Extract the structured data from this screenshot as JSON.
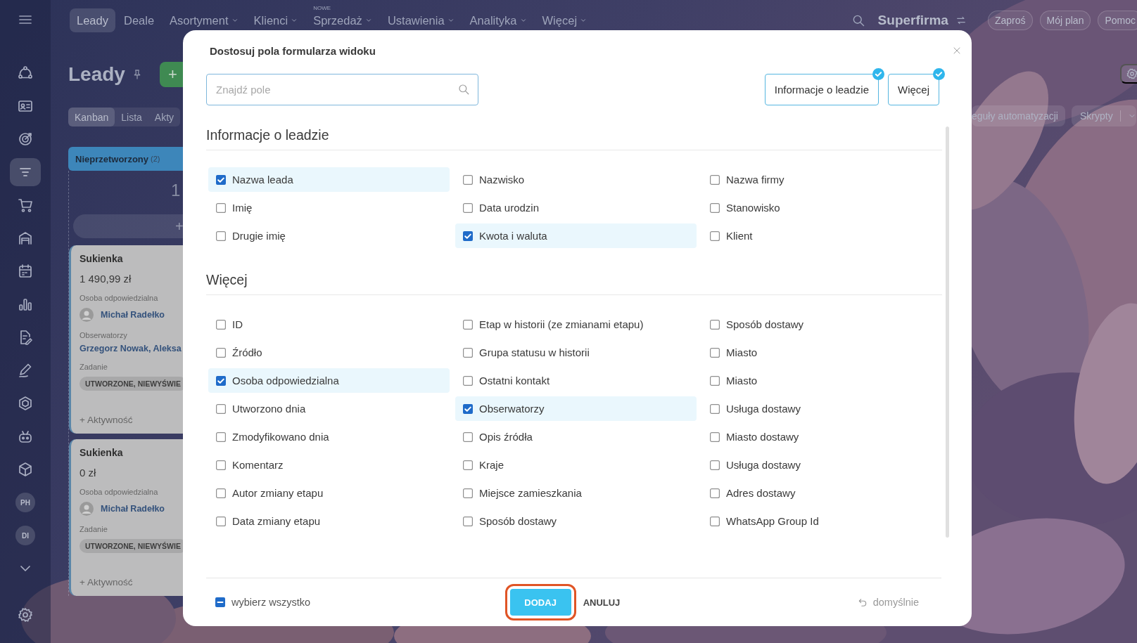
{
  "topbar": {
    "nav": [
      {
        "label": "Leady",
        "selected": true,
        "dropdown": false
      },
      {
        "label": "Deale",
        "selected": false,
        "dropdown": false
      },
      {
        "label": "Asortyment",
        "selected": false,
        "dropdown": true
      },
      {
        "label": "Klienci",
        "selected": false,
        "dropdown": true
      },
      {
        "label": "Sprzedaż",
        "selected": false,
        "dropdown": true,
        "badge": "NOWE"
      },
      {
        "label": "Ustawienia",
        "selected": false,
        "dropdown": true
      },
      {
        "label": "Analityka",
        "selected": false,
        "dropdown": true
      },
      {
        "label": "Więcej",
        "selected": false,
        "dropdown": true
      }
    ],
    "company": "Superfirma",
    "actions": [
      "Zaproś",
      "Mój plan",
      "Pomoc"
    ]
  },
  "sidebar": {
    "items": [
      {
        "kind": "network",
        "selected": false
      },
      {
        "kind": "contacts",
        "selected": false
      },
      {
        "kind": "target",
        "selected": false
      },
      {
        "kind": "funnel",
        "selected": true
      },
      {
        "kind": "cart",
        "selected": false
      },
      {
        "kind": "store",
        "selected": false
      },
      {
        "kind": "calendar",
        "selected": false
      },
      {
        "kind": "chart",
        "selected": false
      },
      {
        "kind": "document",
        "selected": false
      },
      {
        "kind": "pen",
        "selected": false
      },
      {
        "kind": "hexagon",
        "selected": false
      },
      {
        "kind": "robot",
        "selected": false
      },
      {
        "kind": "cube",
        "selected": false
      },
      {
        "kind": "avatar",
        "label": "PH",
        "selected": false
      },
      {
        "kind": "avatar",
        "label": "DI",
        "selected": false
      },
      {
        "kind": "more",
        "selected": false
      }
    ]
  },
  "page": {
    "title": "Leady",
    "add_label": "+",
    "view_tabs": [
      {
        "label": "Kanban",
        "selected": true
      },
      {
        "label": "Lista",
        "selected": false
      },
      {
        "label": "Akty",
        "selected": false
      }
    ],
    "toolbar": [
      "eguły automatyzacji",
      "Skrypty"
    ],
    "column": {
      "title": "Nieprzetworzony",
      "count": "(2)",
      "total": "1",
      "add_label": "+",
      "cards": [
        {
          "title": "Sukienka",
          "amount": "1 490,99 zł",
          "fields": [
            {
              "kind": "person",
              "label": "Osoba odpowiedzialna",
              "value": "Michał Radełko"
            },
            {
              "kind": "link",
              "label": "Obserwatorzy",
              "value": "Grzegorz Nowak, Aleksa"
            },
            {
              "kind": "tag",
              "label": "Zadanie",
              "value": "UTWORZONE, NIEWYŚWIE"
            }
          ],
          "activity": "+ Aktywność"
        },
        {
          "title": "Sukienka",
          "amount": "0 zł",
          "fields": [
            {
              "kind": "person",
              "label": "Osoba odpowiedzialna",
              "value": "Michał Radełko"
            },
            {
              "kind": "tag",
              "label": "Zadanie",
              "value": "UTWORZONE, NIEWYŚWIE"
            }
          ],
          "activity": "+ Aktywność"
        }
      ]
    }
  },
  "modal": {
    "title": "Dostosuj pola formularza widoku",
    "search": {
      "placeholder": "Znajdź pole"
    },
    "section_buttons": [
      {
        "label": "Informacje o leadzie",
        "checked": true
      },
      {
        "label": "Więcej",
        "checked": true
      }
    ],
    "sections": [
      {
        "title": "Informacje o leadzie",
        "fields": [
          {
            "label": "Nazwa leada",
            "checked": true
          },
          {
            "label": "Nazwisko",
            "checked": false
          },
          {
            "label": "Nazwa firmy",
            "checked": false
          },
          {
            "label": "Imię",
            "checked": false
          },
          {
            "label": "Data urodzin",
            "checked": false
          },
          {
            "label": "Stanowisko",
            "checked": false
          },
          {
            "label": "Drugie imię",
            "checked": false
          },
          {
            "label": "Kwota i waluta",
            "checked": true
          },
          {
            "label": "Klient",
            "checked": false
          }
        ]
      },
      {
        "title": "Więcej",
        "fields": [
          {
            "label": "ID",
            "checked": false
          },
          {
            "label": "Etap w historii (ze zmianami etapu)",
            "checked": false
          },
          {
            "label": "Sposób dostawy",
            "checked": false
          },
          {
            "label": "Źródło",
            "checked": false
          },
          {
            "label": "Grupa statusu w historii",
            "checked": false
          },
          {
            "label": "Miasto",
            "checked": false
          },
          {
            "label": "Osoba odpowiedzialna",
            "checked": true
          },
          {
            "label": "Ostatni kontakt",
            "checked": false
          },
          {
            "label": "Miasto",
            "checked": false
          },
          {
            "label": "Utworzono dnia",
            "checked": false
          },
          {
            "label": "Obserwatorzy",
            "checked": true
          },
          {
            "label": "Usługa dostawy",
            "checked": false
          },
          {
            "label": "Zmodyfikowano dnia",
            "checked": false
          },
          {
            "label": "Opis źródła",
            "checked": false
          },
          {
            "label": "Miasto dostawy",
            "checked": false
          },
          {
            "label": "Komentarz",
            "checked": false
          },
          {
            "label": "Kraje",
            "checked": false
          },
          {
            "label": "Usługa dostawy",
            "checked": false
          },
          {
            "label": "Autor zmiany etapu",
            "checked": false
          },
          {
            "label": "Miejsce zamieszkania",
            "checked": false
          },
          {
            "label": "Adres dostawy",
            "checked": false
          },
          {
            "label": "Data zmiany etapu",
            "checked": false
          },
          {
            "label": "Sposób dostawy",
            "checked": false
          },
          {
            "label": "WhatsApp Group Id",
            "checked": false
          }
        ]
      }
    ],
    "select_all": {
      "label": "wybierz wszystko",
      "indeterminate": true
    },
    "add_button": {
      "label": "DODAJ",
      "highlighted": true
    },
    "cancel_button": "ANULUJ",
    "reset": "domyślnie"
  }
}
